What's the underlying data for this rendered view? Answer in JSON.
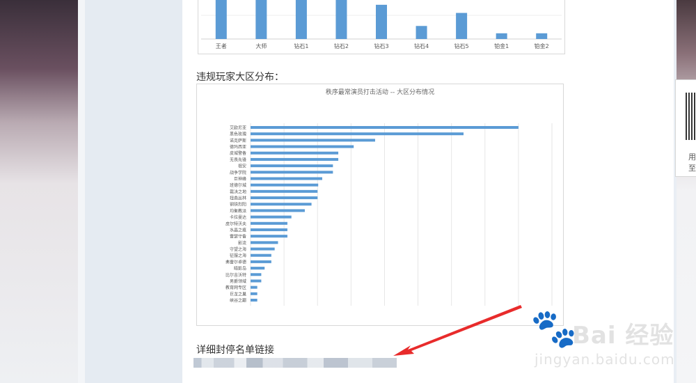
{
  "page": {
    "section_distribution_title": "违规玩家大区分布：",
    "section_link_title": "详细封停名单链接",
    "qr_text_1": "用",
    "qr_text_2": "至"
  },
  "watermark": {
    "logo": "Bai 经验",
    "url": "jingyan.baidu.com"
  },
  "chart_data": [
    {
      "type": "bar",
      "title": "",
      "categories": [
        "王者",
        "大师",
        "钻石1",
        "钻石2",
        "钻石3",
        "钻石4",
        "钻石5",
        "铂金1",
        "铂金2"
      ],
      "values": [
        100,
        100,
        100,
        100,
        42,
        16,
        32,
        7,
        7
      ],
      "ylim": [
        0,
        100
      ],
      "color": "#5b9bd5"
    },
    {
      "type": "bar",
      "orientation": "horizontal",
      "title": "秩序最常演员打击活动 -- 大区分布情况",
      "categories": [
        "艾欧尼亚",
        "黑色玫瑰",
        "诺克萨斯",
        "德玛西亚",
        "皮城警备",
        "无畏先锋",
        "祖安",
        "战争学院",
        "巨神峰",
        "班德尔城",
        "裁决之地",
        "扭曲丛林",
        "钢铁烈阳",
        "均衡教派",
        "卡拉曼达",
        "皮尔特沃夫",
        "水晶之痕",
        "雷瑟守备",
        "影流",
        "守望之海",
        "征服之海",
        "弗雷尔卓德",
        "暗影岛",
        "比尔吉沃特",
        "男爵领域",
        "教育网专区",
        "巨龙之巢",
        "峡谷之巅"
      ],
      "values": [
        400,
        318,
        186,
        154,
        131,
        131,
        123,
        123,
        107,
        101,
        100,
        100,
        91,
        81,
        61,
        55,
        55,
        55,
        41,
        36,
        31,
        31,
        21,
        16,
        16,
        10,
        10,
        10
      ],
      "xlim": [
        0,
        450
      ],
      "grid": true,
      "color": "#5b9bd5"
    }
  ]
}
